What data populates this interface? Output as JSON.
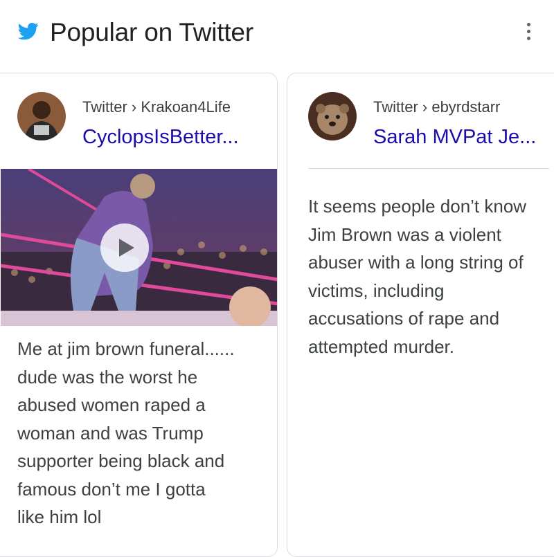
{
  "header": {
    "title": "Popular on Twitter",
    "logo_icon": "twitter-bird-icon",
    "more_icon": "more-vert-icon",
    "brand_color": "#1da1f2"
  },
  "cards": [
    {
      "source": "Twitter › Krakoan4Life",
      "author": "CyclopsIsBetter...",
      "has_video": true,
      "media_icon": "play-icon",
      "text": "Me at jim brown funeral......\ndude was the worst he\nabused women raped a\nwoman and was Trump\nsupporter being black and\nfamous don’t me I gotta\nlike him lol"
    },
    {
      "source": "Twitter › ebyrdstarr",
      "author": "Sarah MVPat Je...",
      "has_video": false,
      "text": "It seems people don’t know\nJim Brown was a violent\nabuser with a long string of\nvictims, including\naccusations of rape and\nattempted murder."
    }
  ],
  "colors": {
    "link": "#1a0dab",
    "text": "#3c4043",
    "title": "#202124",
    "border": "#dadce0"
  }
}
